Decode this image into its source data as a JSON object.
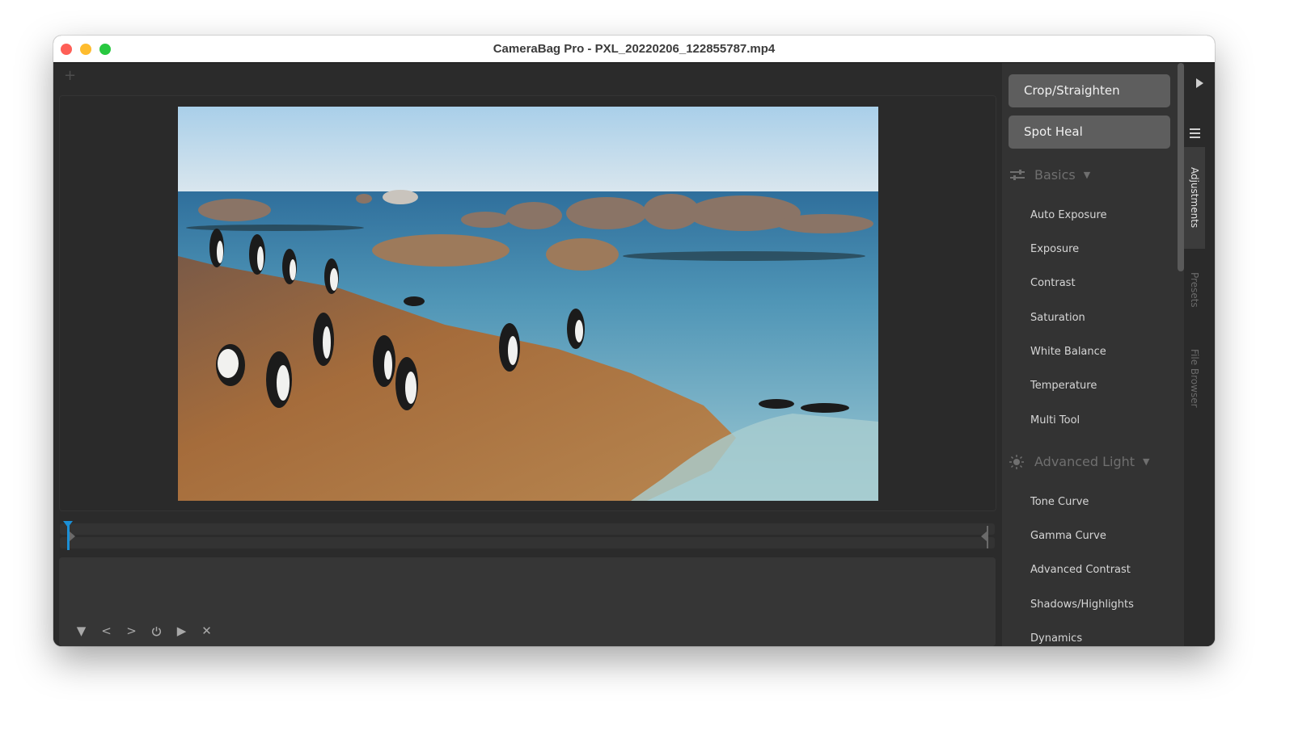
{
  "window": {
    "title": "CameraBag Pro - PXL_20220206_122855787.mp4"
  },
  "viewer": {
    "add_tab_label": "+",
    "photo_alt": "Penguins on a rocky shore next to the sea"
  },
  "timeline": {
    "playhead_position": 0.0
  },
  "controls": [
    {
      "name": "collapse-button",
      "icon": "triangle-down-icon",
      "glyph": "▼"
    },
    {
      "name": "previous-button",
      "icon": "chevron-left-icon",
      "glyph": "<"
    },
    {
      "name": "next-button",
      "icon": "chevron-right-icon",
      "glyph": ">"
    },
    {
      "name": "power-button",
      "icon": "power-icon",
      "glyph": "⏻"
    },
    {
      "name": "play-button",
      "icon": "play-icon",
      "glyph": "▶"
    },
    {
      "name": "close-button",
      "icon": "close-icon",
      "glyph": "✕"
    }
  ],
  "sidebar": {
    "tools": [
      {
        "label": "Crop/Straighten"
      },
      {
        "label": "Spot Heal"
      }
    ],
    "sections": [
      {
        "title": "Basics",
        "icon": "sliders-icon",
        "items": [
          "Auto Exposure",
          "Exposure",
          "Contrast",
          "Saturation",
          "White Balance",
          "Temperature",
          "Multi Tool"
        ]
      },
      {
        "title": "Advanced Light",
        "icon": "sun-icon",
        "items": [
          "Tone Curve",
          "Gamma Curve",
          "Advanced Contrast",
          "Shadows/Highlights",
          "Dynamics"
        ]
      }
    ]
  },
  "right_strip": {
    "tabs": [
      {
        "label": "Adjustments",
        "active": true
      },
      {
        "label": "Presets",
        "active": false
      },
      {
        "label": "File Browser",
        "active": false
      }
    ]
  }
}
